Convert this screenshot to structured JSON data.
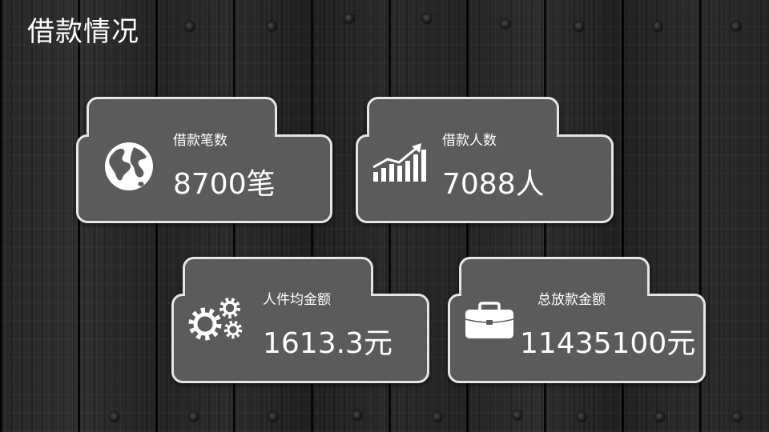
{
  "slide": {
    "title": "借款情况"
  },
  "cards": [
    {
      "label": "借款笔数",
      "value": "8700笔",
      "icon": "globe-icon"
    },
    {
      "label": "借款人数",
      "value": "7088人",
      "icon": "bar-chart-growth-icon"
    },
    {
      "label": "人件均金额",
      "value": "1613.3元",
      "icon": "gears-icon"
    },
    {
      "label": "总放款金额",
      "value": "11435100元",
      "icon": "briefcase-icon"
    }
  ],
  "colors": {
    "card_fill": "#5b5b5b",
    "card_border": "#e6e6e6",
    "text": "#ffffff"
  }
}
